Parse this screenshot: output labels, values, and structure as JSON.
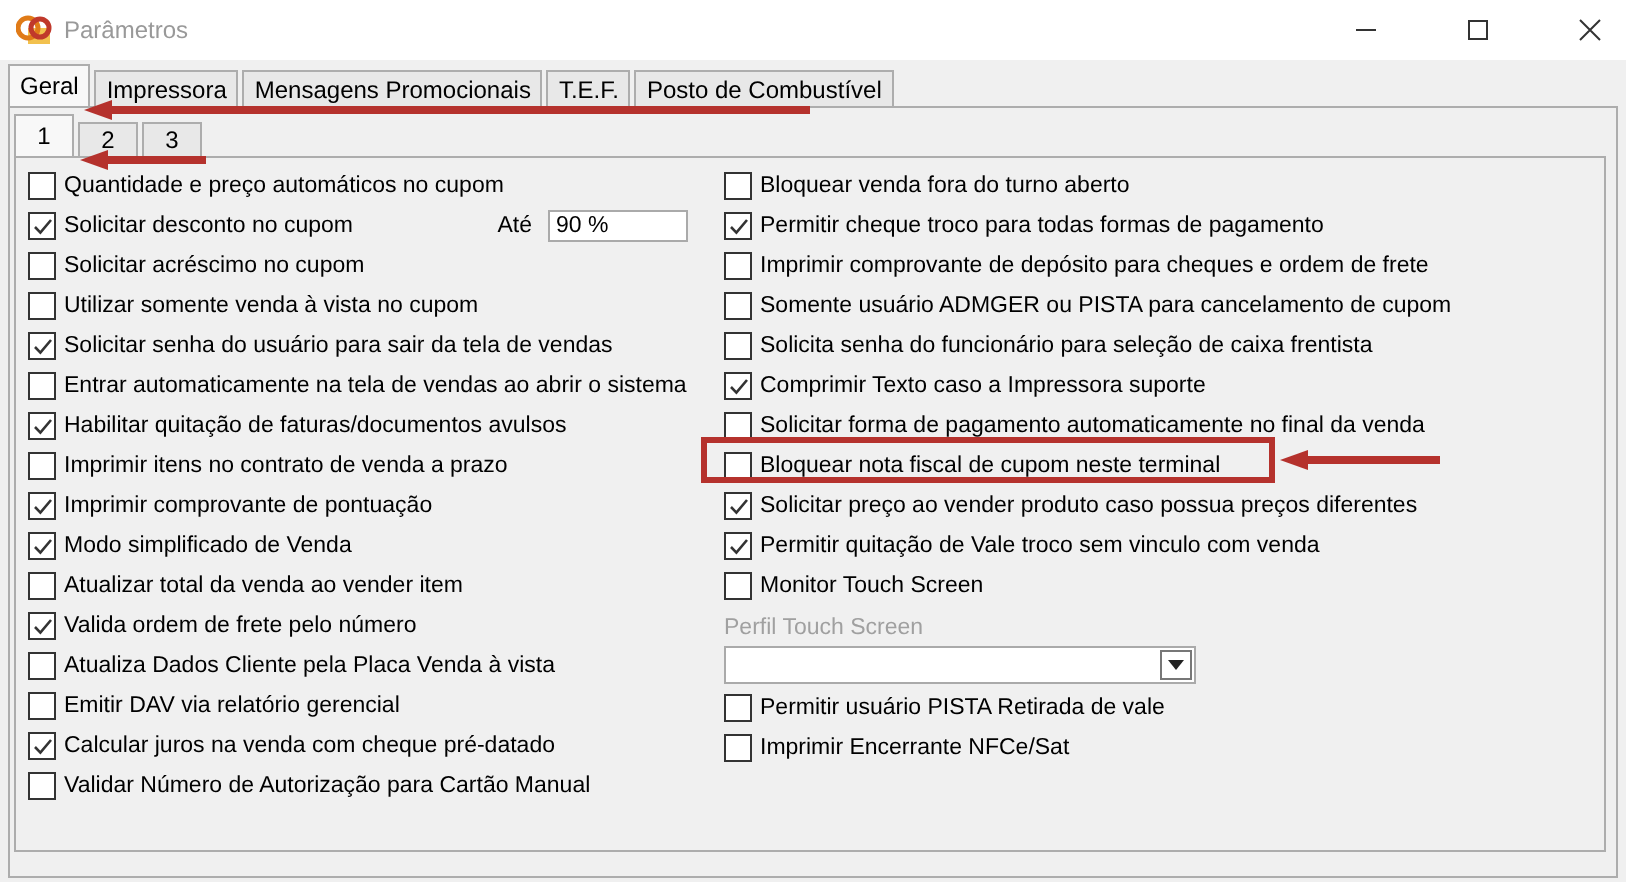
{
  "window": {
    "title": "Parâmetros"
  },
  "tabs": [
    {
      "label": "Geral",
      "selected": true
    },
    {
      "label": "Impressora",
      "selected": false
    },
    {
      "label": "Mensagens Promocionais",
      "selected": false
    },
    {
      "label": "T.E.F.",
      "selected": false
    },
    {
      "label": "Posto de Combustível",
      "selected": false
    }
  ],
  "subtabs": [
    {
      "label": "1",
      "selected": true
    },
    {
      "label": "2",
      "selected": false
    },
    {
      "label": "3",
      "selected": false
    }
  ],
  "left_options": [
    {
      "label": "Quantidade e preço automáticos no cupom",
      "checked": false
    },
    {
      "label": "Solicitar desconto no cupom",
      "checked": true,
      "limit_label": "Até",
      "limit_value": "90 %"
    },
    {
      "label": "Solicitar acréscimo no cupom",
      "checked": false
    },
    {
      "label": "Utilizar somente venda à vista no cupom",
      "checked": false
    },
    {
      "label": "Solicitar senha do usuário para sair da tela de vendas",
      "checked": true
    },
    {
      "label": "Entrar automaticamente na tela de vendas ao abrir o sistema",
      "checked": false
    },
    {
      "label": "Habilitar quitação de faturas/documentos avulsos",
      "checked": true
    },
    {
      "label": "Imprimir itens no contrato de venda a prazo",
      "checked": false
    },
    {
      "label": "Imprimir comprovante de pontuação",
      "checked": true
    },
    {
      "label": "Modo simplificado de Venda",
      "checked": true
    },
    {
      "label": "Atualizar total da venda ao vender item",
      "checked": false
    },
    {
      "label": "Valida ordem de frete pelo número",
      "checked": true
    },
    {
      "label": "Atualiza Dados Cliente pela Placa Venda à vista",
      "checked": false
    },
    {
      "label": "Emitir DAV via relatório gerencial",
      "checked": false
    },
    {
      "label": "Calcular juros na venda com cheque pré-datado",
      "checked": true
    },
    {
      "label": "Validar Número de Autorização para Cartão Manual",
      "checked": false
    }
  ],
  "right_options": [
    {
      "kind": "checkbox",
      "label": "Bloquear venda fora do turno aberto",
      "checked": false
    },
    {
      "kind": "checkbox",
      "label": "Permitir cheque troco para todas formas de pagamento",
      "checked": true
    },
    {
      "kind": "checkbox",
      "label": "Imprimir comprovante de depósito para cheques e ordem de frete",
      "checked": false
    },
    {
      "kind": "checkbox",
      "label": "Somente usuário ADMGER ou PISTA para cancelamento de cupom",
      "checked": false
    },
    {
      "kind": "checkbox",
      "label": "Solicita senha do funcionário para seleção de caixa frentista",
      "checked": false
    },
    {
      "kind": "checkbox",
      "label": "Comprimir Texto caso a Impressora suporte",
      "checked": true
    },
    {
      "kind": "checkbox",
      "label": "Solicitar forma de pagamento automaticamente no final da venda",
      "checked": false
    },
    {
      "kind": "checkbox",
      "label": "Bloquear nota fiscal de cupom neste terminal",
      "checked": false
    },
    {
      "kind": "checkbox",
      "label": "Solicitar preço ao vender produto caso possua preços diferentes",
      "checked": true
    },
    {
      "kind": "checkbox",
      "label": "Permitir quitação de Vale troco sem vinculo com venda",
      "checked": true
    },
    {
      "kind": "checkbox",
      "label": "Monitor Touch Screen",
      "checked": false
    },
    {
      "kind": "label",
      "label": "Perfil Touch Screen",
      "disabled": true
    },
    {
      "kind": "combo"
    },
    {
      "kind": "checkbox",
      "label": "Permitir usuário PISTA Retirada de vale",
      "checked": false
    },
    {
      "kind": "checkbox",
      "label": "Imprimir Encerrante NFCe/Sat",
      "checked": false
    }
  ]
}
